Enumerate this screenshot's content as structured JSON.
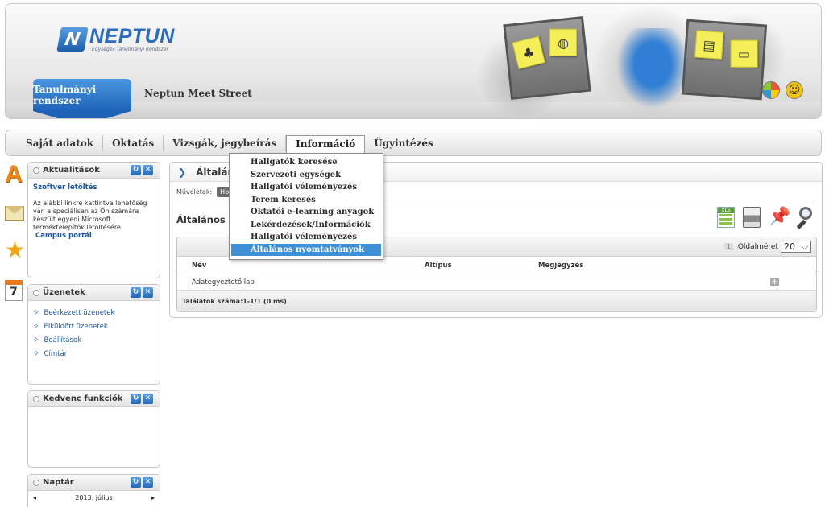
{
  "header": {
    "logo_name": "NEPTUN",
    "logo_subtitle": "Egységes Tanulmányi Rendszer",
    "system_tab": "Tanulmányi rendszer",
    "meet_street": "Neptun Meet Street"
  },
  "menu": {
    "items": [
      "Saját adatok",
      "Oktatás",
      "Vizsgák, jegybeírás",
      "Információ",
      "Ügyintézés"
    ],
    "active_index": 3
  },
  "dropdown": {
    "items": [
      "Hallgatók keresése",
      "Szervezeti egységek",
      "Hallgatói véleményezés",
      "Terem keresés",
      "Oktatói e-learning anyagok",
      "Lekérdezések/Információk",
      "Hallgatói véleményezés",
      "Általános nyomtatványok"
    ],
    "selected_index": 7
  },
  "boxes": {
    "news": {
      "title": "Aktualitások",
      "link_title": "Szoftver letöltés",
      "text": "Az alábbi linkre kattintva lehetőség van a speciálisan az Ön számára készült egyedi Microsoft terméktelepítők letöltésére.",
      "link": "Campus portál"
    },
    "messages": {
      "title": "Üzenetek",
      "items": [
        "Beérkezett üzenetek",
        "Elküldött üzenetek",
        "Beállítások",
        "Címtár"
      ]
    },
    "favorites": {
      "title": "Kedvenc funkciók"
    },
    "calendar": {
      "title": "Naptár",
      "month": "2013. július"
    }
  },
  "main": {
    "title": "Általán",
    "ops_label": "Műveletek:",
    "ops_button": "Ho",
    "section_title": "Általános ny",
    "page_num": "1",
    "page_size_label": "Oldalméret",
    "page_size": "20",
    "columns": [
      "Név",
      "Altípus",
      "Megjegyzés"
    ],
    "rows": [
      {
        "name": "Adategyeztető lap",
        "subtype": "",
        "note": ""
      }
    ],
    "footer": "Találatok száma:1-1/1 (0 ms)"
  },
  "icons": {
    "side": [
      "a-icon",
      "mail-icon",
      "star-icon",
      "calendar-icon"
    ],
    "toolbar": [
      "excel-export-icon",
      "print-icon",
      "pin-icon",
      "zoom-icon"
    ]
  },
  "colors": {
    "brand_blue": "#2a6cc2",
    "menu_highlight": "#3d8fd6",
    "link_blue": "#1a56a8"
  }
}
